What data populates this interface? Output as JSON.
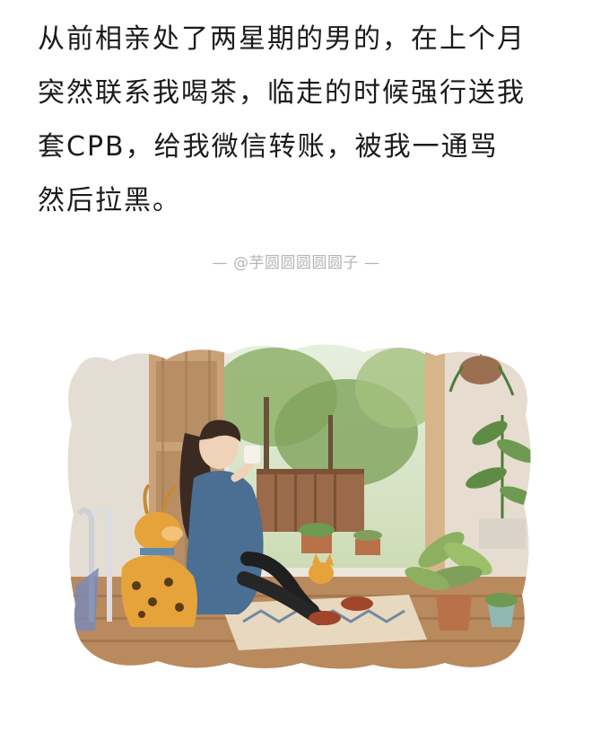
{
  "article": {
    "lines": [
      "从前相亲处了两星期的男的，在上个月",
      "突然联系我喝茶，临走的时候强行送我",
      "套CPB，给我微信转账，被我一通骂",
      "然后拉黑。"
    ]
  },
  "attribution": {
    "left_dash": "—",
    "handle": "@芋圆圆圆圆圆子",
    "right_dash": "—"
  },
  "illustration": {
    "subject": "watercolor-girl-drinking-tea-at-open-door",
    "colors": {
      "door": "#c9a27a",
      "wall": "#e9e3da",
      "dress": "#4a6f92",
      "hair": "#3a2a22",
      "dog": "#e6a33a",
      "foliage": "#7fa05a",
      "floor": "#b98a5e",
      "pot": "#b9714a"
    }
  }
}
